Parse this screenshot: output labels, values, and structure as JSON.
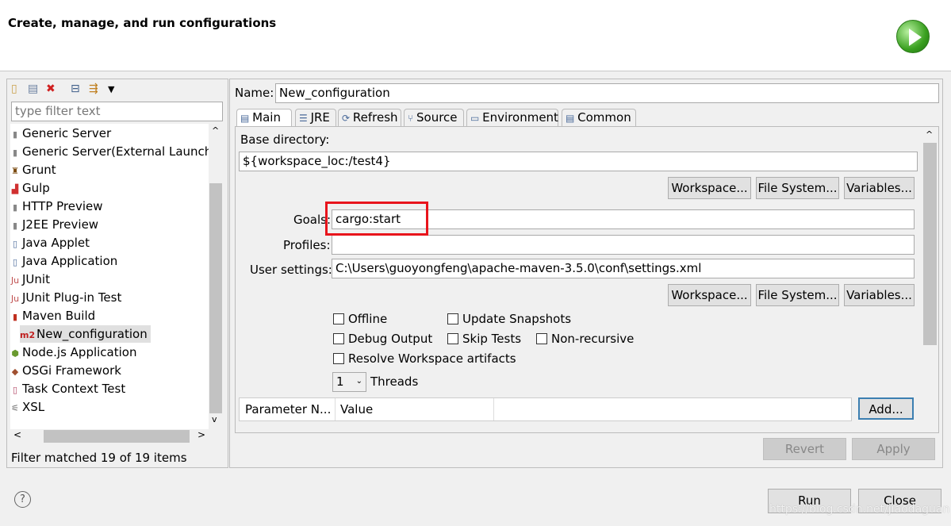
{
  "header": {
    "title": "Create, manage, and run configurations",
    "icon": "run-icon"
  },
  "left": {
    "toolbar": [
      "new-config-icon",
      "duplicate-icon",
      "delete-icon",
      "collapse-all-icon",
      "filter-icon",
      "dropdown-icon"
    ],
    "filter_placeholder": "type filter text",
    "items": [
      {
        "label": "Generic Server",
        "icon": "server-icon"
      },
      {
        "label": "Generic Server(External Launch)",
        "icon": "server-icon"
      },
      {
        "label": "Grunt",
        "icon": "grunt-icon"
      },
      {
        "label": "Gulp",
        "icon": "gulp-icon"
      },
      {
        "label": "HTTP Preview",
        "icon": "server-icon"
      },
      {
        "label": "J2EE Preview",
        "icon": "server-icon"
      },
      {
        "label": "Java Applet",
        "icon": "java-icon"
      },
      {
        "label": "Java Application",
        "icon": "java-icon"
      },
      {
        "label": "JUnit",
        "icon": "junit-icon"
      },
      {
        "label": "JUnit Plug-in Test",
        "icon": "junit-icon"
      },
      {
        "label": "Maven Build",
        "icon": "maven-icon"
      },
      {
        "label": "New_configuration",
        "icon": "m2-icon",
        "child": true,
        "selected": true
      },
      {
        "label": "Node.js Application",
        "icon": "nodejs-icon"
      },
      {
        "label": "OSGi Framework",
        "icon": "osgi-icon"
      },
      {
        "label": "Task Context Test",
        "icon": "task-icon"
      },
      {
        "label": "XSL",
        "icon": "xsl-icon"
      }
    ],
    "filter_status": "Filter matched 19 of 19 items"
  },
  "right": {
    "name_label": "Name:",
    "name_value": "New_configuration",
    "tabs": [
      "Main",
      "JRE",
      "Refresh",
      "Source",
      "Environment",
      "Common"
    ],
    "base_dir_label": "Base directory:",
    "base_dir_value": "${workspace_loc:/test4}",
    "workspace": "Workspace...",
    "file_system": "File System...",
    "variables": "Variables...",
    "goals_label": "Goals:",
    "goals_value": "cargo:start",
    "profiles_label": "Profiles:",
    "profiles_value": "",
    "user_settings_label": "User settings:",
    "user_settings_value": "C:\\Users\\guoyongfeng\\apache-maven-3.5.0\\conf\\settings.xml",
    "checkboxes": {
      "offline": "Offline",
      "update": "Update Snapshots",
      "debug": "Debug Output",
      "skip": "Skip Tests",
      "nonrec": "Non-recursive",
      "resolve": "Resolve Workspace artifacts"
    },
    "threads_value": "1",
    "threads_label": "Threads",
    "param_col": "Parameter N...",
    "value_col": "Value",
    "add": "Add...",
    "revert": "Revert",
    "apply": "Apply"
  },
  "footer": {
    "run": "Run",
    "close": "Close",
    "help_icon": "help-icon",
    "watermark": "https://blog.csdn.net/jiaodaguan"
  },
  "colors": {
    "highlight": "#e8141c"
  }
}
